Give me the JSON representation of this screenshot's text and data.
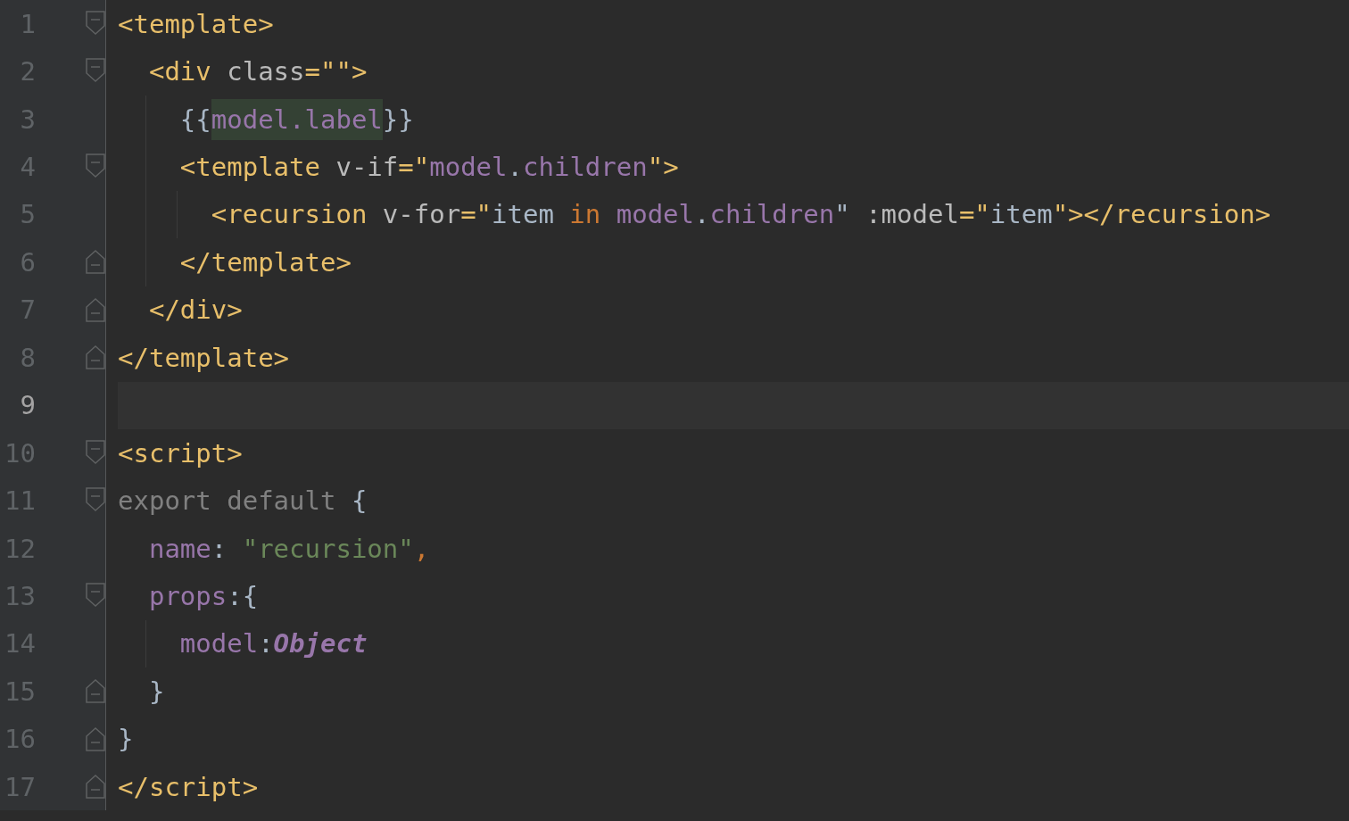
{
  "editor": {
    "lines": [
      {
        "number": "1",
        "current": false,
        "fold_start": true,
        "fold_end": false,
        "tokens": [
          {
            "text": "<template>",
            "kind": "tag"
          }
        ]
      },
      {
        "number": "2",
        "current": false,
        "fold_start": true,
        "fold_end": false,
        "tokens": [
          {
            "text": "  <div",
            "kind": "tag"
          },
          {
            "text": " class",
            "kind": "attr"
          },
          {
            "text": "=\"\">",
            "kind": "tag"
          }
        ]
      },
      {
        "number": "3",
        "current": false,
        "fold_start": false,
        "fold_end": false,
        "tokens": [
          {
            "text": "    {{",
            "kind": "plain"
          },
          {
            "text": "model.label",
            "kind": "prop",
            "highlighted": true
          },
          {
            "text": "}}",
            "kind": "plain"
          }
        ]
      },
      {
        "number": "4",
        "current": false,
        "fold_start": true,
        "fold_end": false,
        "tokens": [
          {
            "text": "    <template",
            "kind": "tag"
          },
          {
            "text": " v-if",
            "kind": "attr"
          },
          {
            "text": "=\"",
            "kind": "tag"
          },
          {
            "text": "model",
            "kind": "prop"
          },
          {
            "text": ".",
            "kind": "plain"
          },
          {
            "text": "children",
            "kind": "prop"
          },
          {
            "text": "\">",
            "kind": "tag"
          }
        ]
      },
      {
        "number": "5",
        "current": false,
        "fold_start": false,
        "fold_end": false,
        "tokens": [
          {
            "text": "      <recursion",
            "kind": "tag"
          },
          {
            "text": " v-for",
            "kind": "attr"
          },
          {
            "text": "=\"",
            "kind": "tag"
          },
          {
            "text": "item ",
            "kind": "plain"
          },
          {
            "text": "in",
            "kind": "keyword"
          },
          {
            "text": " model",
            "kind": "prop"
          },
          {
            "text": ".",
            "kind": "plain"
          },
          {
            "text": "children",
            "kind": "prop"
          },
          {
            "text": "\"",
            "kind": "plain"
          },
          {
            "text": " :model",
            "kind": "attr"
          },
          {
            "text": "=\"",
            "kind": "tag"
          },
          {
            "text": "item",
            "kind": "plain"
          },
          {
            "text": "\"></recursion>",
            "kind": "tag"
          }
        ]
      },
      {
        "number": "6",
        "current": false,
        "fold_start": false,
        "fold_end": true,
        "tokens": [
          {
            "text": "    </template>",
            "kind": "tag"
          }
        ]
      },
      {
        "number": "7",
        "current": false,
        "fold_start": false,
        "fold_end": true,
        "tokens": [
          {
            "text": "  </div>",
            "kind": "tag"
          }
        ]
      },
      {
        "number": "8",
        "current": false,
        "fold_start": false,
        "fold_end": true,
        "tokens": [
          {
            "text": "</template>",
            "kind": "tag"
          }
        ]
      },
      {
        "number": "9",
        "current": true,
        "fold_start": false,
        "fold_end": false
      },
      {
        "number": "10",
        "current": false,
        "fold_start": true,
        "fold_end": false,
        "tokens": [
          {
            "text": "<script>",
            "kind": "tag"
          }
        ]
      },
      {
        "number": "11",
        "current": false,
        "fold_start": true,
        "fold_end": false,
        "tokens": [
          {
            "text": "export default ",
            "kind": "dim"
          },
          {
            "text": "{",
            "kind": "plain"
          }
        ]
      },
      {
        "number": "12",
        "current": false,
        "fold_start": false,
        "fold_end": false,
        "tokens": [
          {
            "text": "  name",
            "kind": "prop"
          },
          {
            "text": ": ",
            "kind": "plain"
          },
          {
            "text": "\"recursion\"",
            "kind": "string"
          },
          {
            "text": ",",
            "kind": "keyword"
          }
        ]
      },
      {
        "number": "13",
        "current": false,
        "fold_start": true,
        "fold_end": false,
        "tokens": [
          {
            "text": "  props",
            "kind": "prop"
          },
          {
            "text": ":{",
            "kind": "plain"
          }
        ]
      },
      {
        "number": "14",
        "current": false,
        "fold_start": false,
        "fold_end": false,
        "tokens": [
          {
            "text": "    model",
            "kind": "prop"
          },
          {
            "text": ":",
            "kind": "plain"
          },
          {
            "text": "Object",
            "kind": "type"
          }
        ]
      },
      {
        "number": "15",
        "current": false,
        "fold_start": false,
        "fold_end": true,
        "tokens": [
          {
            "text": "  }",
            "kind": "plain"
          }
        ]
      },
      {
        "number": "16",
        "current": false,
        "fold_start": false,
        "fold_end": true,
        "tokens": [
          {
            "text": "}",
            "kind": "plain"
          }
        ]
      },
      {
        "number": "17",
        "current": false,
        "fold_start": false,
        "fold_end": true,
        "tokens": [
          {
            "text": "</script>",
            "kind": "tag"
          }
        ]
      }
    ]
  }
}
